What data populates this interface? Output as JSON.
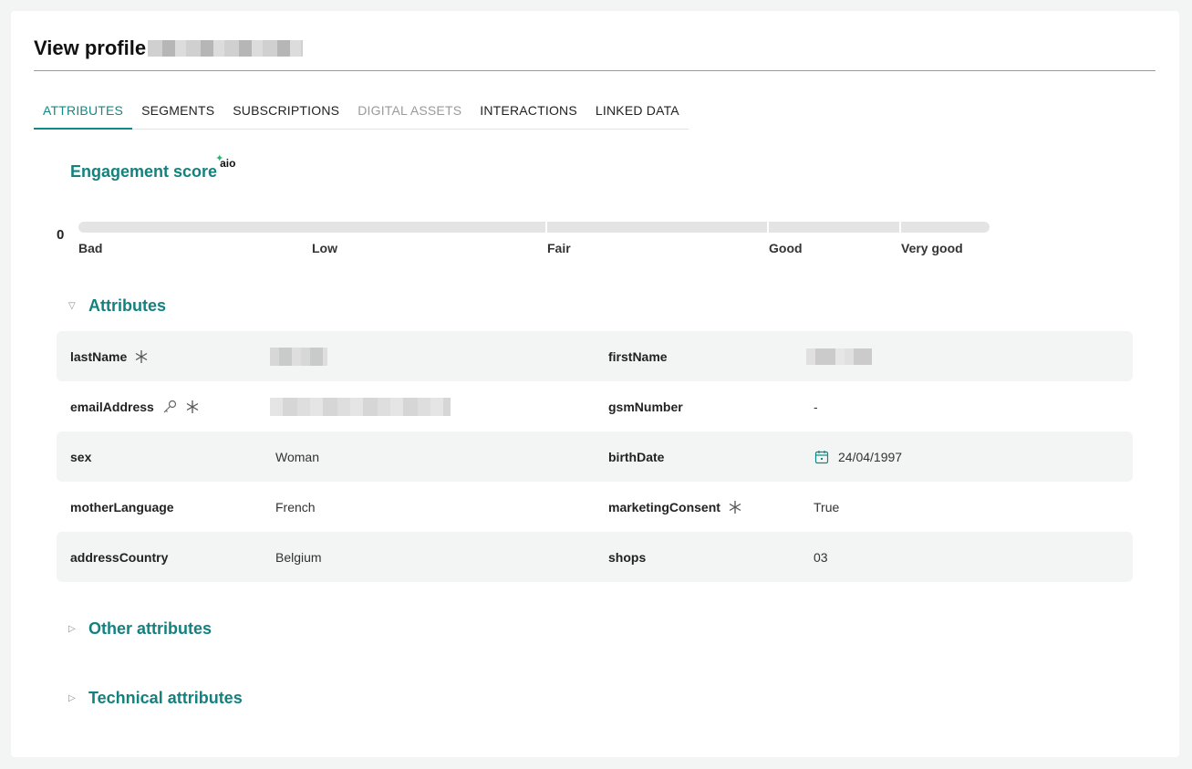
{
  "page": {
    "title": "View profile"
  },
  "tabs": [
    {
      "label": "ATTRIBUTES",
      "state": "active"
    },
    {
      "label": "SEGMENTS",
      "state": "normal"
    },
    {
      "label": "SUBSCRIPTIONS",
      "state": "normal"
    },
    {
      "label": "DIGITAL ASSETS",
      "state": "disabled"
    },
    {
      "label": "INTERACTIONS",
      "state": "normal"
    },
    {
      "label": "LINKED DATA",
      "state": "normal"
    }
  ],
  "engagement": {
    "heading": "Engagement score",
    "badge": "aio",
    "score": "0",
    "levels": [
      "Bad",
      "Low",
      "Fair",
      "Good",
      "Very good"
    ]
  },
  "sections": {
    "attributes": "Attributes",
    "other": "Other attributes",
    "technical": "Technical attributes"
  },
  "attributes": {
    "rows": [
      {
        "left": {
          "key": "lastName",
          "value": "",
          "redacted": true,
          "required": true,
          "key_icon": false
        },
        "right": {
          "key": "firstName",
          "value": "",
          "redacted": true,
          "required": false
        }
      },
      {
        "left": {
          "key": "emailAddress",
          "value": "",
          "redacted": true,
          "required": true,
          "key_icon": true
        },
        "right": {
          "key": "gsmNumber",
          "value": "-",
          "redacted": false,
          "required": false
        }
      },
      {
        "left": {
          "key": "sex",
          "value": "Woman",
          "redacted": false,
          "required": false,
          "key_icon": false
        },
        "right": {
          "key": "birthDate",
          "value": "24/04/1997",
          "redacted": false,
          "required": false,
          "calendar": true
        }
      },
      {
        "left": {
          "key": "motherLanguage",
          "value": "French",
          "redacted": false,
          "required": false,
          "key_icon": false
        },
        "right": {
          "key": "marketingConsent",
          "value": "True",
          "redacted": false,
          "required": true
        }
      },
      {
        "left": {
          "key": "addressCountry",
          "value": "Belgium",
          "redacted": false,
          "required": false,
          "key_icon": false
        },
        "right": {
          "key": "shops",
          "value": "03",
          "redacted": false,
          "required": false
        }
      }
    ]
  },
  "colors": {
    "accent": "#0f8a86",
    "row_shade": "#f3f4f4",
    "track": "#e4e4e4"
  }
}
